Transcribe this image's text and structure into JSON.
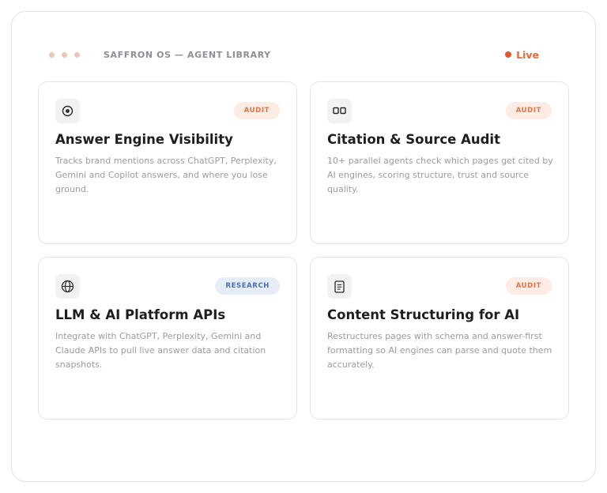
{
  "header": {
    "app_title": "SAFFRON OS — AGENT LIBRARY",
    "status_label": "Live"
  },
  "colors": {
    "accent": "#e0592d",
    "audit_badge_bg": "#fdece4",
    "audit_badge_text": "#d9744a",
    "research_badge_bg": "#e6edf9",
    "research_badge_text": "#4a6fb5"
  },
  "cards": [
    {
      "icon": "target-icon",
      "badge": "AUDIT",
      "title": "Answer Engine Visibility",
      "description": "Tracks brand mentions across ChatGPT, Perplexity, Gemini and Copilot answers, and where you lose ground."
    },
    {
      "icon": "columns-icon",
      "badge": "AUDIT",
      "title": "Citation & Source Audit",
      "description": "10+ parallel agents check which pages get cited by AI engines, scoring structure, trust and source quality."
    },
    {
      "icon": "globe-icon",
      "badge": "RESEARCH",
      "title": "LLM & AI Platform APIs",
      "description": "Integrate with ChatGPT, Perplexity, Gemini and Claude APIs to pull live answer data and citation snapshots."
    },
    {
      "icon": "document-icon",
      "badge": "AUDIT",
      "title": "Content Structuring for AI",
      "description": "Restructures pages with schema and answer-first formatting so AI engines can parse and quote them accurately."
    }
  ]
}
